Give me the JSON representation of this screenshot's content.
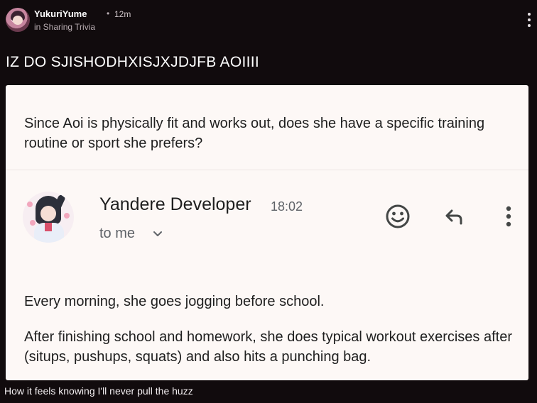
{
  "post": {
    "username": "YukuriYume",
    "separator": "•",
    "time_ago": "12m",
    "community": "in Sharing Trivia",
    "title": "IZ DO SJISHODHXISJXJDJFB AOIIII",
    "caption": "How it feels knowing I'll never pull the huzz"
  },
  "email": {
    "question": "Since Aoi is physically fit and works out, does she have a specific training routine or sport she prefers?",
    "sender_name": "Yandere Developer",
    "sender_time": "18:02",
    "recipient": "to me",
    "body_paragraphs": [
      "Every morning, she goes jogging before school.",
      "After finishing school and homework, she does typical workout exercises after (situps, pushups, squats) and also hits a punching bag."
    ]
  },
  "icons": {
    "post_menu": "kebab-icon",
    "emoji": "smiley-icon",
    "reply": "reply-arrow-icon",
    "more": "kebab-icon",
    "recipient_expand": "chevron-down-icon"
  },
  "colors": {
    "page_background": "#110b0d",
    "card_background": "#fdf8f6",
    "icon_dark": "#444746",
    "secondary_text": "#5f6368"
  }
}
